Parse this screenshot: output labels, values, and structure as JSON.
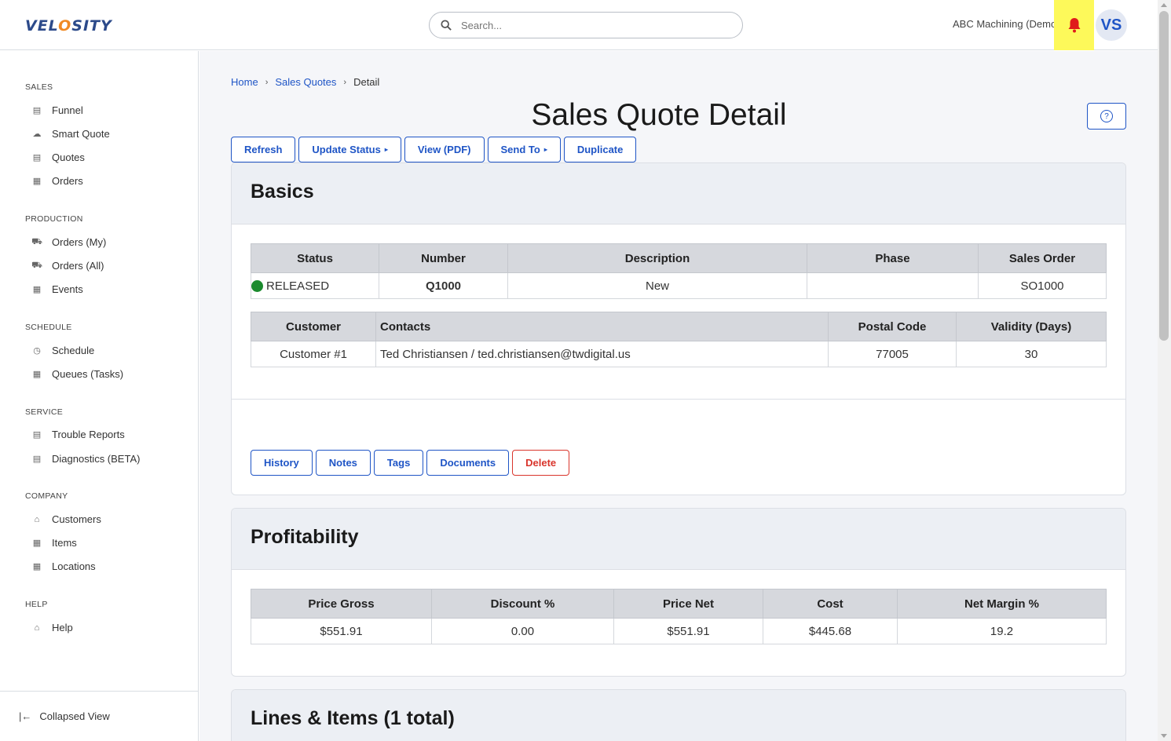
{
  "brand": {
    "logo_pre": "VEL",
    "logo_o": "O",
    "logo_post": "SITY"
  },
  "search": {
    "placeholder": "Search..."
  },
  "header": {
    "company": "ABC Machining (Demo)",
    "avatar_initials": "VS"
  },
  "sidebar": {
    "sections": [
      {
        "title": "SALES",
        "items": [
          "Funnel",
          "Smart Quote",
          "Quotes",
          "Orders"
        ]
      },
      {
        "title": "PRODUCTION",
        "items": [
          "Orders (My)",
          "Orders (All)",
          "Events"
        ]
      },
      {
        "title": "SCHEDULE",
        "items": [
          "Schedule",
          "Queues (Tasks)"
        ]
      },
      {
        "title": "SERVICE",
        "items": [
          "Trouble Reports",
          "Diagnostics (BETA)"
        ]
      },
      {
        "title": "COMPANY",
        "items": [
          "Customers",
          "Items",
          "Locations"
        ]
      },
      {
        "title": "HELP",
        "items": [
          "Help"
        ]
      }
    ],
    "collapsed_label": "Collapsed View"
  },
  "breadcrumb": {
    "home": "Home",
    "parent": "Sales Quotes",
    "current": "Detail"
  },
  "page": {
    "title": "Sales Quote Detail"
  },
  "toolbar": {
    "refresh": "Refresh",
    "update_status": "Update Status",
    "view_pdf": "View (PDF)",
    "send_to": "Send To",
    "duplicate": "Duplicate"
  },
  "basics": {
    "title": "Basics",
    "headers1": [
      "Status",
      "Number",
      "Description",
      "Phase",
      "Sales Order"
    ],
    "row1": {
      "status": "RELEASED",
      "number": "Q1000",
      "description": "New",
      "phase": "",
      "sales_order": "SO1000"
    },
    "headers2": [
      "Customer",
      "Contacts",
      "Postal Code",
      "Validity (Days)"
    ],
    "row2": {
      "customer": "Customer #1",
      "contacts": "Ted Christiansen / ted.christiansen@twdigital.us",
      "postal_code": "77005",
      "validity": "30"
    },
    "actions": {
      "history": "History",
      "notes": "Notes",
      "tags": "Tags",
      "documents": "Documents",
      "delete": "Delete"
    }
  },
  "profitability": {
    "title": "Profitability",
    "headers": [
      "Price Gross",
      "Discount %",
      "Price Net",
      "Cost",
      "Net Margin %"
    ],
    "row": [
      "$551.91",
      "0.00",
      "$551.91",
      "$445.68",
      "19.2"
    ]
  },
  "lines": {
    "title": "Lines & Items (1 total)"
  },
  "colors": {
    "accent": "#1f55c6",
    "danger": "#d9352c",
    "status_ok": "#1b8a2e",
    "highlight": "#fdf95a"
  }
}
